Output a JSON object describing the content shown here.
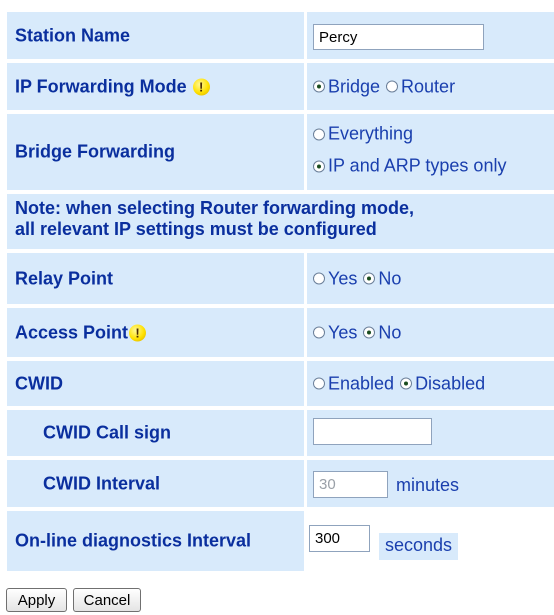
{
  "rows": {
    "station_name": {
      "label": "Station Name",
      "value": "Percy"
    },
    "ip_forwarding_mode": {
      "label": "IP Forwarding Mode",
      "options": [
        "Bridge",
        "Router"
      ],
      "selected": "Bridge"
    },
    "bridge_forwarding": {
      "label": "Bridge Forwarding",
      "options": [
        "Everything",
        "IP and ARP types only"
      ],
      "selected": "IP and ARP types only"
    },
    "note": {
      "line1": "Note: when selecting Router forwarding mode,",
      "line2": "all relevant IP settings must be configured"
    },
    "relay_point": {
      "label": "Relay Point",
      "options": [
        "Yes",
        "No"
      ],
      "selected": "No"
    },
    "access_point": {
      "label": "Access Point",
      "options": [
        "Yes",
        "No"
      ],
      "selected": "No"
    },
    "cwid": {
      "label": "CWID",
      "options": [
        "Enabled",
        "Disabled"
      ],
      "selected": "Disabled"
    },
    "cwid_call_sign": {
      "label": "CWID Call sign",
      "value": ""
    },
    "cwid_interval": {
      "label": "CWID Interval",
      "value": "30",
      "unit": "minutes",
      "disabled": true
    },
    "diagnostics_interval": {
      "label": "On-line diagnostics Interval",
      "value": "300",
      "unit": "seconds"
    }
  },
  "buttons": {
    "apply": "Apply",
    "cancel": "Cancel"
  },
  "icons": {
    "warning": "exclamation-warning-icon"
  },
  "colors": {
    "row_background": "#d8eafb",
    "label_text": "#0a2f9e",
    "value_text": "#1a3fae"
  }
}
